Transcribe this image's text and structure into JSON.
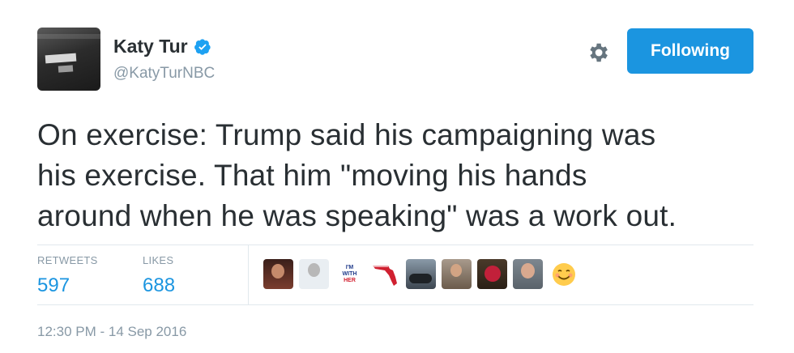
{
  "author": {
    "display_name": "Katy Tur",
    "handle": "@KatyTurNBC",
    "verified": true
  },
  "actions": {
    "follow_label": "Following"
  },
  "tweet": {
    "lines": [
      "On exercise: Trump said his campaigning was",
      "his exercise. That him \"moving his hands",
      "around when he was speaking\" was a work out."
    ]
  },
  "stats": {
    "retweets_label": "RETWEETS",
    "retweets_value": "597",
    "likes_label": "LIKES",
    "likes_value": "688"
  },
  "likers": {
    "badge_top": "I'M",
    "badge_mid": "WITH",
    "badge_bottom": "HER"
  },
  "timestamp": "12:30 PM - 14 Sep 2016",
  "colors": {
    "accent": "#1b95e0",
    "text": "#292f33",
    "muted": "#8899a6",
    "divider": "#e1e8ed"
  },
  "icons": {
    "verified": "verified-badge-icon",
    "settings": "gear-icon",
    "emoji": "smiling-face-icon"
  }
}
